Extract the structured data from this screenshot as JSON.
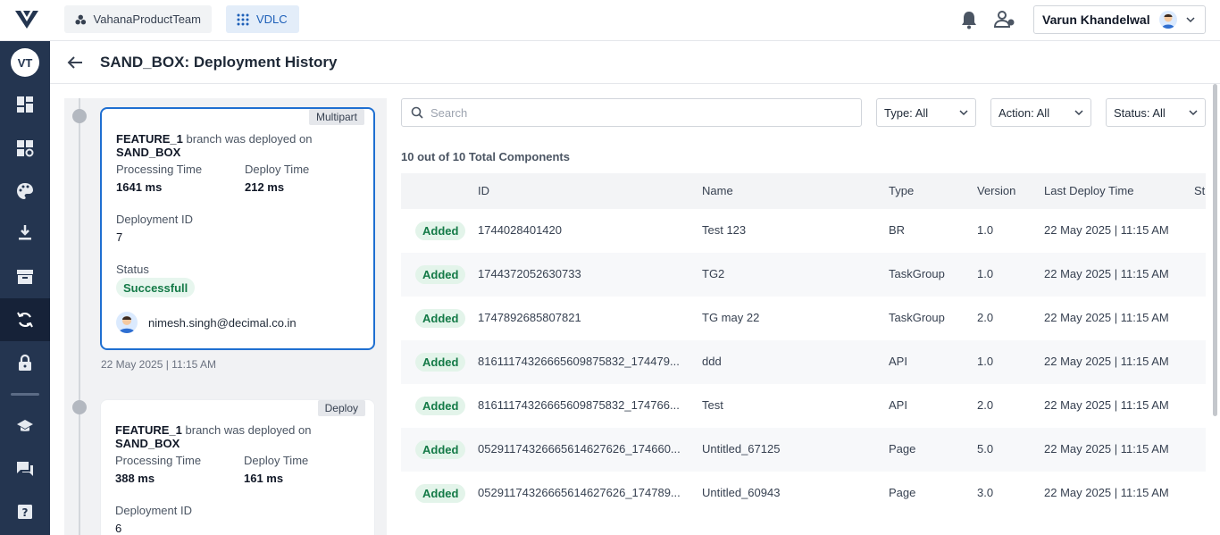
{
  "app": {
    "workspace": "VahanaProductTeam",
    "product": "VDLC",
    "user_name": "Varun Khandelwal"
  },
  "sidebar": {
    "avatar_initials": "VT",
    "items": [
      {
        "icon": "dashboard-icon"
      },
      {
        "icon": "widgets-icon"
      },
      {
        "icon": "palette-icon"
      },
      {
        "icon": "download-icon"
      },
      {
        "icon": "archive-icon"
      },
      {
        "icon": "sync-icon",
        "active": true
      },
      {
        "icon": "lock-icon"
      },
      {
        "icon": "school-icon"
      },
      {
        "icon": "chat-icon"
      },
      {
        "icon": "help-icon"
      }
    ]
  },
  "page": {
    "title": "SAND_BOX: Deployment History"
  },
  "deployments": [
    {
      "tag": "Multipart",
      "branch": "FEATURE_1",
      "headline_mid": "branch was deployed on",
      "env": "SAND_BOX",
      "processing_time_label": "Processing Time",
      "processing_time": "1641 ms",
      "deploy_time_label": "Deploy Time",
      "deploy_time": "212 ms",
      "deployment_id_label": "Deployment ID",
      "deployment_id": "7",
      "status_label": "Status",
      "status": "Successfull",
      "user_email": "nimesh.singh@decimal.co.in",
      "date": "22 May 2025 | 11:15 AM"
    },
    {
      "tag": "Deploy",
      "branch": "FEATURE_1",
      "headline_mid": "branch was deployed on",
      "env": "SAND_BOX",
      "processing_time_label": "Processing Time",
      "processing_time": "388 ms",
      "deploy_time_label": "Deploy Time",
      "deploy_time": "161 ms",
      "deployment_id_label": "Deployment ID",
      "deployment_id": "6"
    }
  ],
  "filters": {
    "search_placeholder": "Search",
    "type": "Type: All",
    "action": "Action: All",
    "status": "Status: All"
  },
  "summary": "10 out of 10 Total Components",
  "table": {
    "columns": [
      "ID",
      "Name",
      "Type",
      "Version",
      "Last Deploy Time",
      "St"
    ],
    "rows": [
      {
        "action": "Added",
        "id": "1744028401420",
        "name": "Test 123",
        "type": "BR",
        "version": "1.0",
        "time": "22 May 2025 | 11:15 AM"
      },
      {
        "action": "Added",
        "id": "1744372052630733",
        "name": "TG2",
        "type": "TaskGroup",
        "version": "1.0",
        "time": "22 May 2025 | 11:15 AM"
      },
      {
        "action": "Added",
        "id": "1747892685807821",
        "name": "TG may 22",
        "type": "TaskGroup",
        "version": "2.0",
        "time": "22 May 2025 | 11:15 AM"
      },
      {
        "action": "Added",
        "id": "8161117432666560987583 2_174479...",
        "name": "ddd",
        "type": "API",
        "version": "1.0",
        "time": "22 May 2025 | 11:15 AM"
      },
      {
        "action": "Added",
        "id": "816111743266656098758 32_174766...",
        "name": "Test",
        "type": "API",
        "version": "2.0",
        "time": "22 May 2025 | 11:15 AM"
      },
      {
        "action": "Added",
        "id": "05291174326665614627626_174660...",
        "name": "Untitled_67125",
        "type": "Page",
        "version": "5.0",
        "time": "22 May 2025 | 11:15 AM"
      },
      {
        "action": "Added",
        "id": "05291174326665614627626_174789...",
        "name": "Untitled_60943",
        "type": "Page",
        "version": "3.0",
        "time": "22 May 2025 | 11:15 AM"
      }
    ]
  }
}
